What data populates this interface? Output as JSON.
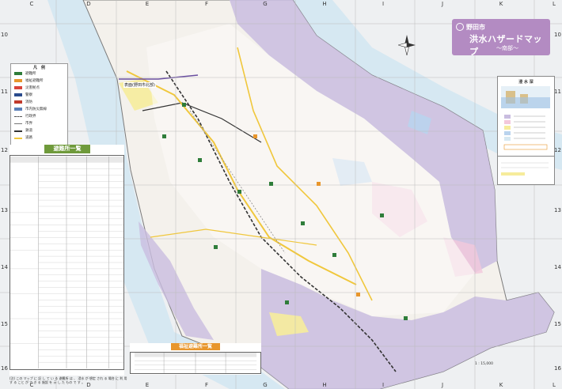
{
  "colors": {
    "land": "#f4f1ec",
    "river": "#d6e8f2",
    "flood_purple": "#c9bde0",
    "flood_pink": "#f3c8dc",
    "flood_yellow": "#f6ec9c",
    "flood_blue": "#b9d3ee",
    "road": "#f0c73c",
    "rail": "#333333",
    "title_bg": "#b38bc2",
    "evac_head": "#6f9a3b",
    "welfare_head": "#e8962c"
  },
  "grid": {
    "columns": [
      "C",
      "D",
      "E",
      "F",
      "G",
      "H",
      "I",
      "J",
      "K",
      "L"
    ],
    "rows": [
      "10",
      "11",
      "12",
      "13",
      "14",
      "15",
      "16"
    ]
  },
  "title": {
    "city": "野田市",
    "main": "洪水ハザードマップ",
    "sub": "〜南部〜"
  },
  "legend": {
    "title": "凡　例",
    "items": [
      {
        "label": "避難所",
        "icon": "evacuation-shelter-icon"
      },
      {
        "label": "福祉避難所",
        "icon": "welfare-shelter-icon"
      },
      {
        "label": "災害拠点",
        "icon": "disaster-base-icon"
      },
      {
        "label": "警察",
        "icon": "police-icon"
      },
      {
        "label": "消防",
        "icon": "fire-station-icon"
      },
      {
        "label": "市内防災無線",
        "icon": "radio-icon"
      },
      {
        "label": "行政界",
        "icon": "boundary-line-icon"
      },
      {
        "label": "市界",
        "icon": "city-boundary-icon"
      },
      {
        "label": "鉄道",
        "icon": "railway-icon"
      },
      {
        "label": "道路",
        "icon": "road-icon"
      }
    ]
  },
  "evacuation_table": {
    "title": "避難所一覧"
  },
  "welfare_table": {
    "title": "福祉避難所一覧"
  },
  "inset": {
    "title": "浸 水 深"
  },
  "places": {
    "north_label": "表面(野田市北部)"
  },
  "scale_text": "1 : 15,000",
  "note_text": "(注) この マップ に 記 し て い る 避難所 は 、 浸水 が 想定 され る 場合 に 利 用 す る こと が で き る 施設 を 示 し た もの で す 。"
}
